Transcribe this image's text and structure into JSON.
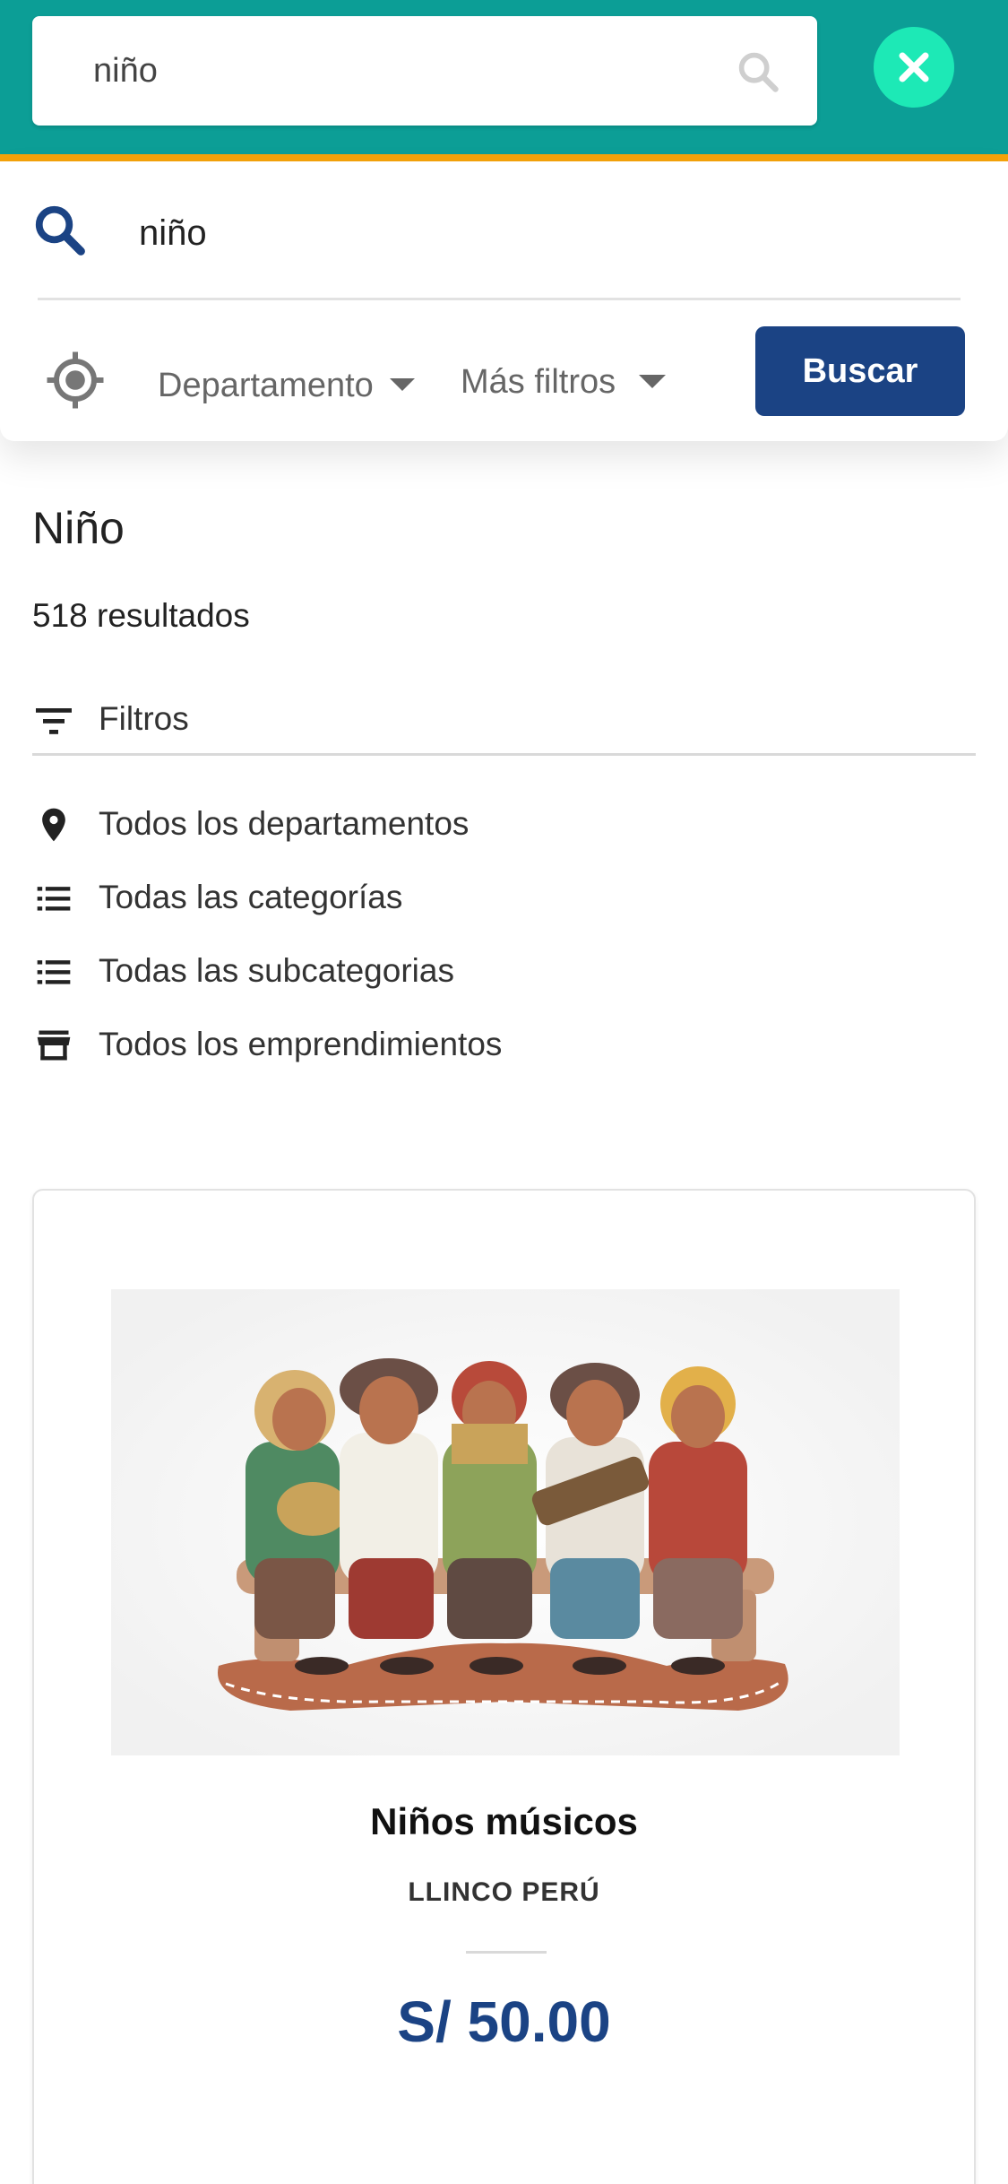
{
  "header": {
    "search_value": "niño",
    "colors": {
      "bar": "#0c9e96",
      "accent": "#f5a30a",
      "close": "#1de9b6"
    },
    "icons": {
      "search": "search-icon",
      "close": "close-icon"
    }
  },
  "panel": {
    "query": "niño",
    "department_label": "Departamento",
    "more_filters_label": "Más filtros",
    "search_button": "Buscar",
    "icons": {
      "search": "search-icon",
      "locate": "locate-icon"
    }
  },
  "results": {
    "title": "Niño",
    "count_text": "518 resultados",
    "filters_label": "Filtros",
    "facets": [
      {
        "label": "Todos los departamentos",
        "icon": "location-pin-icon"
      },
      {
        "label": "Todas las categorías",
        "icon": "list-icon"
      },
      {
        "label": "Todas las subcategorias",
        "icon": "list-icon"
      },
      {
        "label": "Todos los emprendimientos",
        "icon": "store-icon"
      }
    ]
  },
  "product": {
    "name": "Niños músicos",
    "brand": "LLINCO PERÚ",
    "price": "S/ 50.00",
    "image": "ceramic-children-musicians-figurine"
  }
}
